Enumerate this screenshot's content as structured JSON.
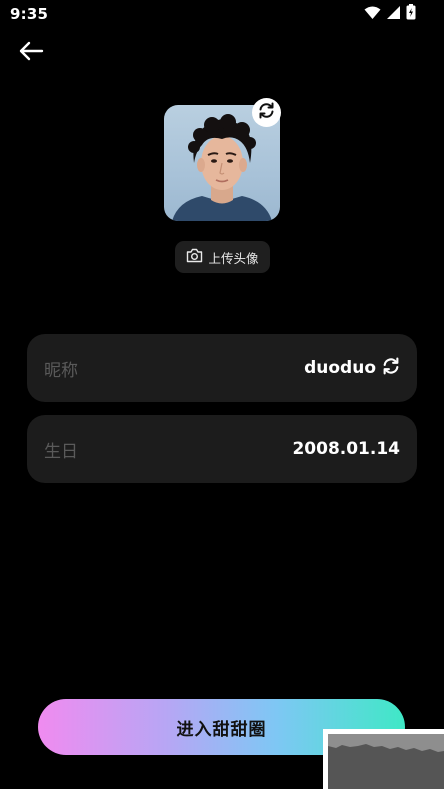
{
  "status_bar": {
    "time": "9:35"
  },
  "nav": {
    "back_icon": "arrow-left-icon"
  },
  "avatar": {
    "refresh_icon": "refresh-icon"
  },
  "upload": {
    "icon": "camera-icon",
    "label": "上传头像"
  },
  "fields": {
    "nickname": {
      "label": "昵称",
      "value": "duoduo",
      "icon": "refresh-icon"
    },
    "birthday": {
      "label": "生日",
      "value": "2008.01.14"
    }
  },
  "cta": {
    "label": "进入甜甜圈"
  },
  "colors": {
    "background": "#000000",
    "field_bg": "#1c1c1c",
    "label_gray": "#5a5a5a",
    "gradient_start": "#f08bf0",
    "gradient_end": "#3fe8c6"
  }
}
